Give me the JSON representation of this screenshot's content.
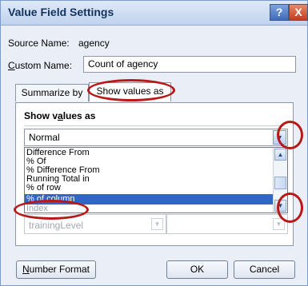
{
  "window": {
    "title": "Value Field Settings",
    "help_label": "?",
    "close_label": "X"
  },
  "source": {
    "label": "Source Name:",
    "value": "agency"
  },
  "custom_name": {
    "label_prefix": "C",
    "label_rest": "ustom Name:",
    "value": "Count of agency"
  },
  "tabs": [
    {
      "label": "Summarize by",
      "active": false
    },
    {
      "label": "Show values as",
      "active": true
    }
  ],
  "section": {
    "head_prefix": "Show v",
    "head_underline": "a",
    "head_rest": "lues as"
  },
  "combo": {
    "selected": "Normal"
  },
  "list_items": [
    "Difference From",
    "% Of",
    "% Difference From",
    "Running Total in",
    "% of row",
    "% of column",
    "Index"
  ],
  "base_list": {
    "visible_item": "trainingLevel"
  },
  "buttons": {
    "number_format_prefix": "N",
    "number_format_rest": "umber Format",
    "ok": "OK",
    "cancel": "Cancel"
  },
  "colors": {
    "selection": "#3066c6",
    "highlight_circle": "#b91818",
    "title_text": "#12335f"
  }
}
